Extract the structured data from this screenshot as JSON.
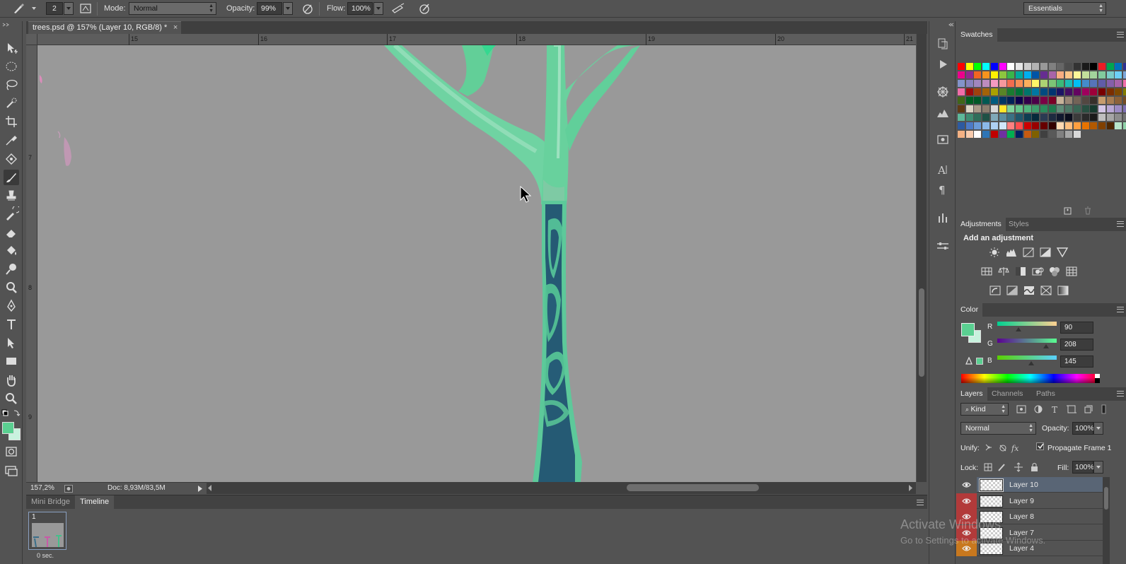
{
  "options_bar": {
    "brush_size": "2",
    "mode_label": "Mode:",
    "mode_value": "Normal",
    "opacity_label": "Opacity:",
    "opacity_value": "99%",
    "flow_label": "Flow:",
    "flow_value": "100%",
    "workspace": "Essentials"
  },
  "document": {
    "tab_title": "trees.psd @ 157% (Layer 10, RGB/8) *",
    "close_glyph": "×"
  },
  "rulers": {
    "horizontal": [
      "15",
      "16",
      "17",
      "18",
      "19",
      "20",
      "21"
    ],
    "vertical": [
      "7",
      "8",
      "9"
    ]
  },
  "status": {
    "zoom": "157,2%",
    "doc_size": "Doc: 8,93M/83,5M"
  },
  "bottom_panel": {
    "tabs": [
      "Mini Bridge",
      "Timeline"
    ],
    "active_tab": "Timeline",
    "frame_number": "1",
    "frame_delay": "0 sec."
  },
  "swatches": {
    "title": "Swatches",
    "rows": [
      [
        "#ff0000",
        "#ffff00",
        "#00ff00",
        "#00ffff",
        "#0000ff",
        "#ff00ff",
        "#ffffff",
        "#e6e6e6",
        "#cccccc",
        "#b3b3b3",
        "#999999",
        "#808080",
        "#666666",
        "#4d4d4d",
        "#333333",
        "#1a1a1a",
        "#000000",
        "#ed1c24",
        "#00a651",
        "#0072bc",
        "#2e3192"
      ],
      [
        "#ec008c",
        "#92278f",
        "#f26522",
        "#f7941d",
        "#fff200",
        "#8dc63f",
        "#39b54a",
        "#00a99d",
        "#00aeef",
        "#0054a6",
        "#662d91",
        "#a864a8",
        "#f9ad81",
        "#fdc689",
        "#fff799",
        "#c4df9b",
        "#a3d39c",
        "#82ca9d",
        "#7accc8",
        "#6dcff6",
        "#7da7d9"
      ],
      [
        "#8393ca",
        "#8781bd",
        "#a186be",
        "#bd8cbf",
        "#f49ac1",
        "#f5989d",
        "#f26c4f",
        "#f68e56",
        "#fbaf5d",
        "#fff568",
        "#acd373",
        "#7cc576",
        "#3cb878",
        "#1cbbb4",
        "#00bff3",
        "#448ccb",
        "#5674b9",
        "#605ca8",
        "#855fa8",
        "#a763a8",
        "#f06eaa"
      ],
      [
        "#f06ea9",
        "#9e0b0f",
        "#a0410d",
        "#a36209",
        "#aba000",
        "#598527",
        "#197b30",
        "#007236",
        "#00746b",
        "#0076a3",
        "#004a80",
        "#003471",
        "#1b1464",
        "#440e62",
        "#630460",
        "#9e005d",
        "#9e0039",
        "#790000",
        "#7b2e00",
        "#7d4900",
        "#827b00"
      ],
      [
        "#406618",
        "#005e20",
        "#005826",
        "#005952",
        "#005b7f",
        "#003663",
        "#002157",
        "#0d004c",
        "#32004b",
        "#4b0049",
        "#7b0046",
        "#7a0026",
        "#c7b299",
        "#998675",
        "#736357",
        "#534741",
        "#37302a",
        "#c69c6d",
        "#a67c52",
        "#8c6239",
        "#754c24"
      ],
      [
        "#603913",
        "#dcd5c5",
        "#a89a88",
        "#8a7d6e",
        "#d8d8d8",
        "#ffe62a",
        "#7fd29b",
        "#63c48a",
        "#4fb37c",
        "#3d9e6c",
        "#2a8c5c",
        "#1f7a4e",
        "#5f8c78",
        "#4d7866",
        "#3a6655",
        "#284f41",
        "#163a2e",
        "#d4c6e6",
        "#b9a8d5",
        "#9c8bc4",
        "#7f6fb2"
      ],
      [
        "#5eb89a",
        "#3e8c72",
        "#2e6e5a",
        "#1f5145",
        "#7fa8b8",
        "#5a8da0",
        "#3b7185",
        "#1f566b",
        "#0e3d52",
        "#062a3b",
        "#2a3a52",
        "#1d2a40",
        "#11182e",
        "#0a0d1c",
        "#3b3b3b",
        "#2a2a2a",
        "#1a1a1a",
        "#bfbfbf",
        "#a6a6a6",
        "#8c8c8c",
        "#737373"
      ],
      [
        "#2d5aa0",
        "#4c7ac6",
        "#6a9bd8",
        "#8bb8e8",
        "#aed0f2",
        "#d0e6fb",
        "#ff8080",
        "#ff4d4d",
        "#cc0000",
        "#990000",
        "#660000",
        "#330000",
        "#ffd9b3",
        "#ffbf80",
        "#ff9f40",
        "#e67300",
        "#b35900",
        "#804000",
        "#4d2600",
        "#b8e6c9",
        "#8fd1a8"
      ],
      [
        "#f4b183",
        "#f8cbad",
        "#ffffff",
        "#2e75b6",
        "#c00000",
        "#7030a0",
        "#00b050",
        "#002060",
        "#c55a11",
        "#7f6000",
        "#404040",
        "#595959",
        "#808080",
        "#a6a6a6",
        "#d9d9d9"
      ]
    ]
  },
  "adjustments": {
    "tabs": [
      "Adjustments",
      "Styles"
    ],
    "heading": "Add an adjustment"
  },
  "color": {
    "title": "Color",
    "foreground": "#5ad091",
    "background": "#c8f2de",
    "r_label": "R",
    "r_value": "90",
    "r_fraction": 0.353,
    "g_label": "G",
    "g_value": "208",
    "g_fraction": 0.816,
    "b_label": "B",
    "b_value": "145",
    "b_fraction": 0.569
  },
  "layers": {
    "tabs": [
      "Layers",
      "Channels",
      "Paths"
    ],
    "kind_label": "Kind",
    "blend_mode": "Normal",
    "opacity_label": "Opacity:",
    "opacity_value": "100%",
    "unify_label": "Unify:",
    "propagate_label": "Propagate Frame 1",
    "lock_label": "Lock:",
    "fill_label": "Fill:",
    "fill_value": "100%",
    "items": [
      {
        "name": "Layer 10",
        "selected": true,
        "eye_color": "#535353"
      },
      {
        "name": "Layer 9",
        "selected": false,
        "eye_color": "#b23a3a"
      },
      {
        "name": "Layer 8",
        "selected": false,
        "eye_color": "#b23a3a"
      },
      {
        "name": "Layer 7",
        "selected": false,
        "eye_color": "#b23a3a"
      },
      {
        "name": "Layer 4",
        "selected": false,
        "eye_color": "#c8781e"
      }
    ]
  },
  "watermark": {
    "line1": "Activate Windows",
    "line2": "Go to Settings to activate Windows."
  },
  "canvas": {
    "background_color": "#999999",
    "branch_color": "#5fcf98",
    "trunk_color": "#235a76"
  }
}
